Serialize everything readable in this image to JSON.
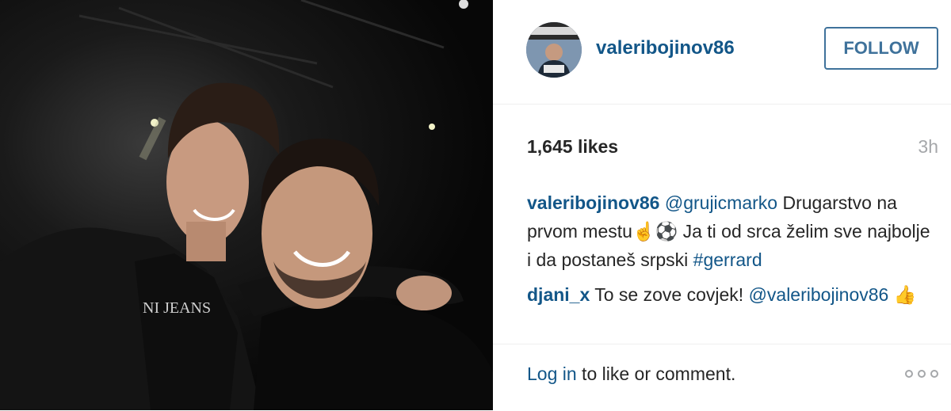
{
  "post": {
    "username": "valeribojinov86",
    "follow_label": "FOLLOW",
    "likes": "1,645 likes",
    "time": "3h",
    "caption": {
      "author": "valeribojinov86",
      "mention": "@grujicmarko",
      "text_part1": " Drugarstvo na prvom mestu",
      "emoji1": "☝",
      "emoji2": "⚽",
      "text_part2": " Ja ti od srca želim sve najbolje i da postaneš srpski ",
      "hashtag": "#gerrard"
    },
    "comment": {
      "author": "djani_x",
      "text": " To se zove covjek! ",
      "mention": "@valeribojinov86",
      "emoji": "👍"
    },
    "footer": {
      "login_link": "Log in",
      "login_text": " to like or comment."
    }
  },
  "icons": {
    "more": "more-options-icon"
  }
}
